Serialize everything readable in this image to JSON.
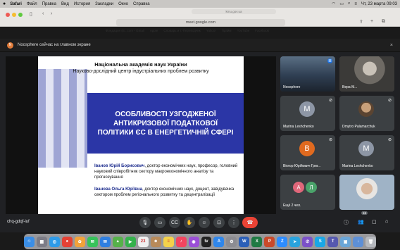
{
  "menubar": {
    "apple_icon": "apple-icon",
    "items": [
      "Safari",
      "Файл",
      "Правка",
      "Вид",
      "История",
      "Закладки",
      "Окно",
      "Справка"
    ],
    "datetime": "Чт, 23 марта 09:03"
  },
  "browser": {
    "top_tab_url": "kmu.gov.ua",
    "address": "meet.google.com",
    "favorites": [
      "Фондация (B...com - Gmail",
      "Apple",
      "Словарь и т.-Переводчик",
      "Yahoo!",
      "Прайм",
      "YouTube",
      "Facebook"
    ]
  },
  "notification": {
    "text": "Noosphere сейчас на главном экране",
    "close": "×"
  },
  "slide": {
    "header1": "Національна академія наук України",
    "header2": "Науково-дослідний центр індустріальних проблем розвитку",
    "title_lines": [
      "ОСОБЛИВОСТІ УЗГОДЖЕНОЇ",
      "АНТИКРИЗОВОЇ ПОДАТКОВОЇ",
      "ПОЛІТИКИ ЄС В ЕНЕРГЕТИЧНІЙ СФЕРІ"
    ],
    "author1_name": "Іванов Юрій Борисович",
    "author1_desc": ", доктор економічних наук, професор, головний науковий співробітник сектору макроекономічного аналізу та прогнозування",
    "author2_name": "Іванова Ольга Юріївна",
    "author2_desc": ", доктор економічних наук, доцент, завідувачка сектором проблем регіонального розвитку та децентралізації"
  },
  "participants": [
    {
      "name": "Noosphere",
      "type": "photo"
    },
    {
      "name": "Вера М...",
      "type": "photo"
    },
    {
      "name": "Marina Leshchenko",
      "type": "avatar",
      "letter": "M",
      "color": "#8d96a5"
    },
    {
      "name": "Dmytro Palamarchuk",
      "type": "photo"
    },
    {
      "name": "Віктор Юрійович Григ...",
      "type": "avatar",
      "letter": "В",
      "color": "#e06a1f"
    },
    {
      "name": "Marina Leshchenko",
      "type": "avatar",
      "letter": "M",
      "color": "#8d96a5"
    },
    {
      "name": "Ещё 2 чел.",
      "type": "multi",
      "letters": [
        "А",
        "Л"
      ],
      "colors": [
        "#e0677a",
        "#4aa36a"
      ]
    },
    {
      "name": "",
      "type": "photo"
    }
  ],
  "meeting": {
    "code": "chq-gdqf-iuf",
    "participant_count": "16",
    "controls": [
      "mic-icon",
      "camera-icon",
      "captions-icon",
      "hand-icon",
      "emoji-icon",
      "present-icon",
      "more-icon",
      "end-call-icon"
    ],
    "right_controls": [
      "info-icon",
      "people-icon",
      "chat-icon",
      "activities-icon"
    ]
  },
  "dock": {
    "apps": [
      {
        "icon": "finder-icon",
        "color": "#3a8ee6",
        "glyph": "☺"
      },
      {
        "icon": "launchpad-icon",
        "color": "#7c7c86",
        "glyph": "▦"
      },
      {
        "icon": "safari-icon",
        "color": "#2f9be8",
        "glyph": "◎"
      },
      {
        "icon": "chrome-icon",
        "color": "#e44134",
        "glyph": "●"
      },
      {
        "icon": "photos-icon",
        "color": "#f2a23a",
        "glyph": "✿"
      },
      {
        "icon": "messages-icon",
        "color": "#37c25a",
        "glyph": "✉"
      },
      {
        "icon": "mail-icon",
        "color": "#2f7fe0",
        "glyph": "✉"
      },
      {
        "icon": "maps-icon",
        "color": "#56b14a",
        "glyph": "▲"
      },
      {
        "icon": "facetime-icon",
        "color": "#35b14c",
        "glyph": "▶"
      },
      {
        "icon": "calendar-icon",
        "color": "#f0f0f0",
        "glyph": "23"
      },
      {
        "icon": "contacts-icon",
        "color": "#b88a5a",
        "glyph": "☻"
      },
      {
        "icon": "notes-icon",
        "color": "#f4d24a",
        "glyph": "≡"
      },
      {
        "icon": "music-icon",
        "color": "#f2455f",
        "glyph": "♪"
      },
      {
        "icon": "podcasts-icon",
        "color": "#9b4fd6",
        "glyph": "◉"
      },
      {
        "icon": "tv-icon",
        "color": "#222222",
        "glyph": "tv"
      },
      {
        "icon": "appstore-icon",
        "color": "#2f86ea",
        "glyph": "A"
      },
      {
        "icon": "settings-icon",
        "color": "#8c8c92",
        "glyph": "⚙"
      },
      {
        "icon": "word-icon",
        "color": "#2b5fb8",
        "glyph": "W"
      },
      {
        "icon": "excel-icon",
        "color": "#1f7a43",
        "glyph": "X"
      },
      {
        "icon": "powerpoint-icon",
        "color": "#c9492a",
        "glyph": "P"
      },
      {
        "icon": "zoom-icon",
        "color": "#2d8cff",
        "glyph": "Z"
      },
      {
        "icon": "telegram-icon",
        "color": "#2aa3dd",
        "glyph": "➤"
      },
      {
        "icon": "viber-icon",
        "color": "#7b51c8",
        "glyph": "✆"
      },
      {
        "icon": "skype-icon",
        "color": "#1aa7e6",
        "glyph": "S"
      },
      {
        "icon": "teams-icon",
        "color": "#5558af",
        "glyph": "T"
      },
      {
        "icon": "preview-icon",
        "color": "#6aa6d8",
        "glyph": "▣"
      },
      {
        "icon": "downloads-icon",
        "color": "#5d8fd6",
        "glyph": "↓"
      },
      {
        "icon": "trash-icon",
        "color": "#b5b8bd",
        "glyph": "🗑"
      }
    ]
  }
}
